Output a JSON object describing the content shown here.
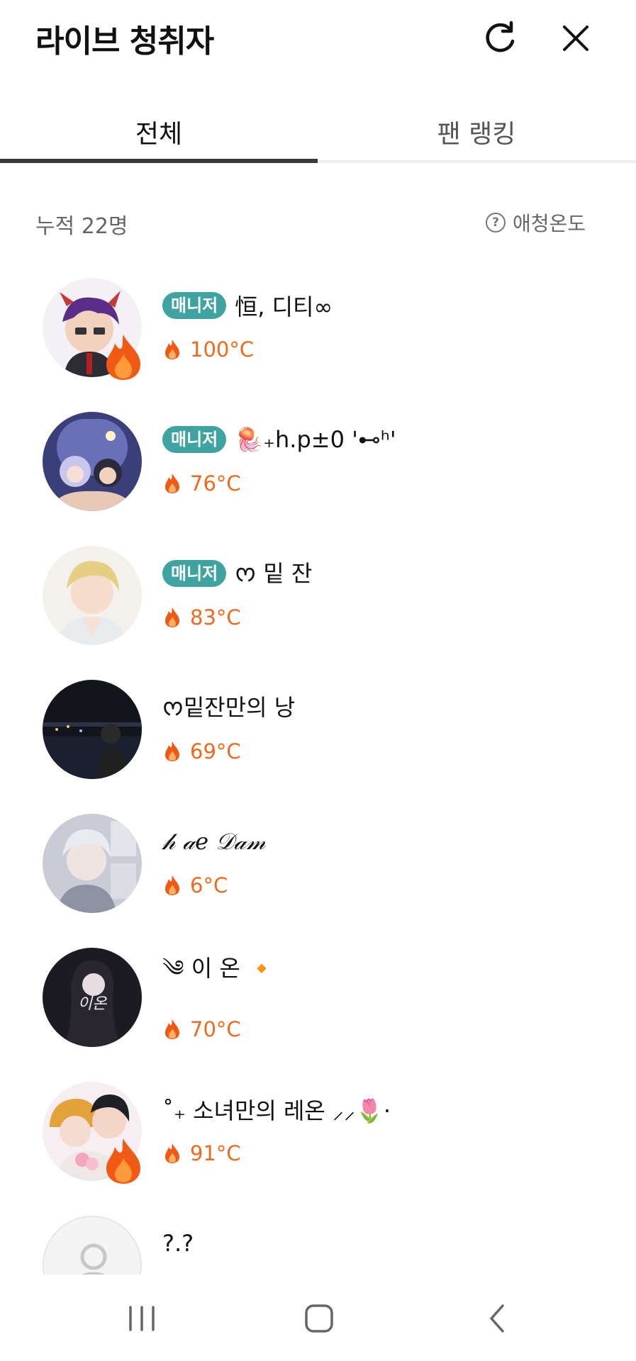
{
  "header": {
    "title": "라이브 청취자"
  },
  "tabs": [
    {
      "label": "전체"
    },
    {
      "label": "팬 랭킹"
    }
  ],
  "summary": {
    "count": "누적 22명",
    "affection_label": "애청온도"
  },
  "listeners": [
    {
      "badge": "매니저",
      "name": "恒, 디티∞",
      "temp": "100°C"
    },
    {
      "badge": "매니저",
      "name": "🪼₊h.p±0 '⊷ʰ'",
      "temp": "76°C"
    },
    {
      "badge": "매니저",
      "name": "ᰔ 밑 잔",
      "temp": "83°C"
    },
    {
      "badge": "",
      "name": "ᰔ밑잔만의 낭",
      "temp": "69°C"
    },
    {
      "badge": "",
      "name": "𝒽 𝒶𝑒 𝒟𝒶𝓂",
      "temp": "6°C"
    },
    {
      "badge": "",
      "name": "༄ 이 온 🔸",
      "temp": "70°C"
    },
    {
      "badge": "",
      "name": "˚₊ 소녀만의 레온 ⸝⸝🌷·",
      "temp": "91°C"
    },
    {
      "badge": "",
      "name": "?.?",
      "temp": ""
    }
  ],
  "colors": {
    "accent": "#ee6a1e",
    "badge": "#3fa3a2"
  }
}
